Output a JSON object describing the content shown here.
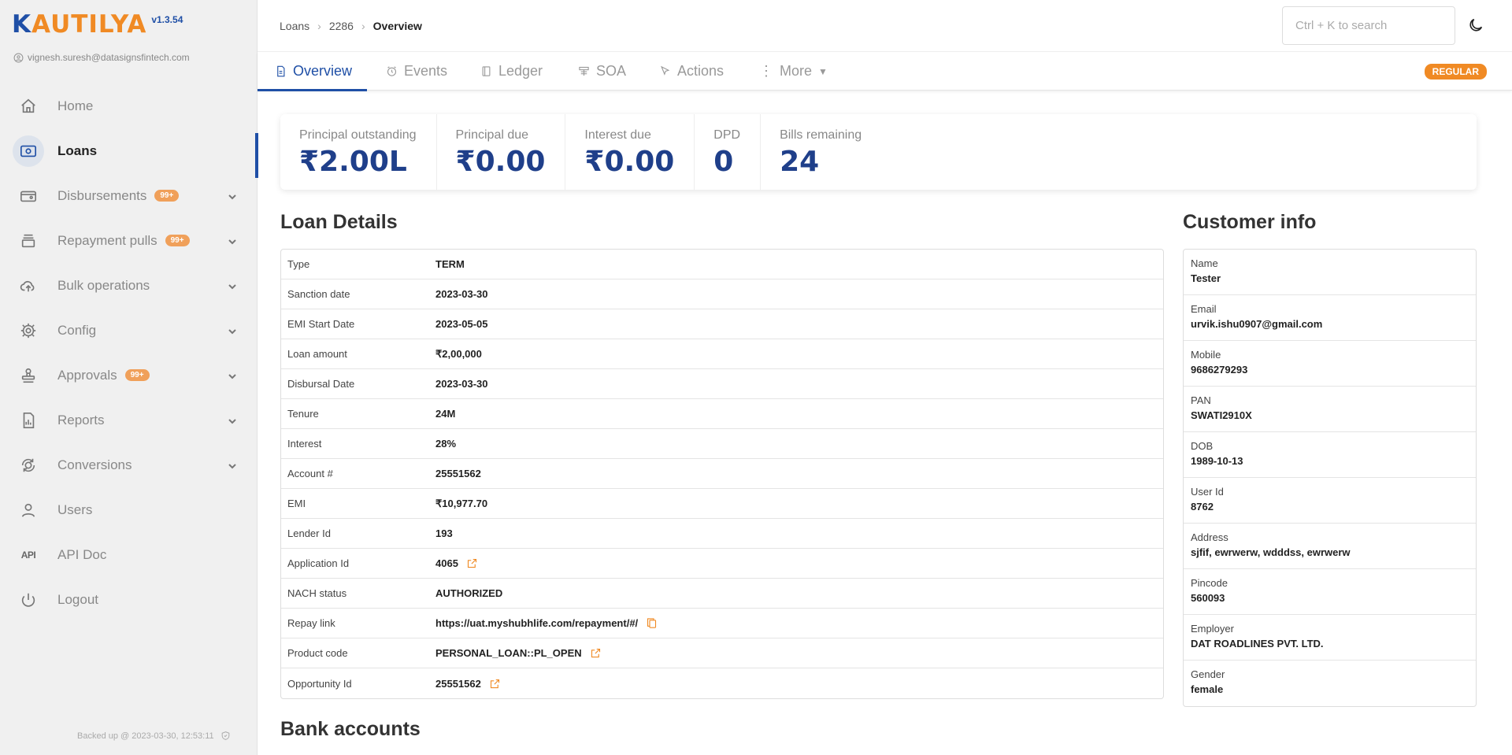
{
  "app": {
    "logo_first": "K",
    "logo_rest": "AUTILYA",
    "version": "v1.3.54",
    "user_email": "vignesh.suresh@datasignsfintech.com",
    "backup_text": "Backed up @ 2023-03-30, 12:53:11"
  },
  "sidebar": {
    "items": [
      {
        "label": "Home",
        "icon": "home-icon"
      },
      {
        "label": "Loans",
        "icon": "loans-icon"
      },
      {
        "label": "Disbursements",
        "icon": "disbursements-icon",
        "badge": "99+"
      },
      {
        "label": "Repayment pulls",
        "icon": "repayment-icon",
        "badge": "99+"
      },
      {
        "label": "Bulk operations",
        "icon": "cloud-upload-icon"
      },
      {
        "label": "Config",
        "icon": "gear-icon"
      },
      {
        "label": "Approvals",
        "icon": "stamp-icon",
        "badge": "99+"
      },
      {
        "label": "Reports",
        "icon": "report-icon"
      },
      {
        "label": "Conversions",
        "icon": "conversions-icon"
      },
      {
        "label": "Users",
        "icon": "user-icon"
      },
      {
        "label": "API Doc",
        "icon": "api-icon",
        "icon_text": "API"
      },
      {
        "label": "Logout",
        "icon": "power-icon"
      }
    ]
  },
  "header": {
    "breadcrumb": [
      "Loans",
      "2286",
      "Overview"
    ],
    "search_placeholder": "Ctrl + K to search"
  },
  "tabs": {
    "items": [
      "Overview",
      "Events",
      "Ledger",
      "SOA",
      "Actions",
      "More"
    ],
    "tag": "REGULAR"
  },
  "stats": [
    {
      "label": "Principal outstanding",
      "value": "₹2.00L"
    },
    {
      "label": "Principal due",
      "value": "₹0.00"
    },
    {
      "label": "Interest due",
      "value": "₹0.00"
    },
    {
      "label": "DPD",
      "value": "0"
    },
    {
      "label": "Bills remaining",
      "value": "24"
    }
  ],
  "loan_details": {
    "title": "Loan Details",
    "rows": [
      {
        "key": "Type",
        "value": "TERM"
      },
      {
        "key": "Sanction date",
        "value": "2023-03-30"
      },
      {
        "key": "EMI Start Date",
        "value": "2023-05-05"
      },
      {
        "key": "Loan amount",
        "value": "₹2,00,000"
      },
      {
        "key": "Disbursal Date",
        "value": "2023-03-30"
      },
      {
        "key": "Tenure",
        "value": "24M"
      },
      {
        "key": "Interest",
        "value": "28%"
      },
      {
        "key": "Account #",
        "value": "25551562"
      },
      {
        "key": "EMI",
        "value": "₹10,977.70"
      },
      {
        "key": "Lender Id",
        "value": "193"
      },
      {
        "key": "Application Id",
        "value": "4065"
      },
      {
        "key": "NACH status",
        "value": "AUTHORIZED"
      },
      {
        "key": "Repay link",
        "value": "https://uat.myshubhlife.com/repayment/#/"
      },
      {
        "key": "Product code",
        "value": "PERSONAL_LOAN::PL_OPEN"
      },
      {
        "key": "Opportunity Id",
        "value": "25551562"
      }
    ]
  },
  "customer_info": {
    "title": "Customer info",
    "rows": [
      {
        "key": "Name",
        "value": "Tester"
      },
      {
        "key": "Email",
        "value": "urvik.ishu0907@gmail.com"
      },
      {
        "key": "Mobile",
        "value": "9686279293"
      },
      {
        "key": "PAN",
        "value": "SWATI2910X"
      },
      {
        "key": "DOB",
        "value": "1989-10-13"
      },
      {
        "key": "User Id",
        "value": "8762"
      },
      {
        "key": "Address",
        "value": "sjfif, ewrwerw, wdddss, ewrwerw"
      },
      {
        "key": "Pincode",
        "value": "560093"
      },
      {
        "key": "Employer",
        "value": "DAT ROADLINES PVT. LTD."
      },
      {
        "key": "Gender",
        "value": "female"
      }
    ]
  },
  "bank_accounts": {
    "title": "Bank accounts"
  },
  "colors": {
    "brand_blue": "#1f4fa6",
    "brand_orange": "#f08a24",
    "stat_value": "#1f3f8a"
  }
}
